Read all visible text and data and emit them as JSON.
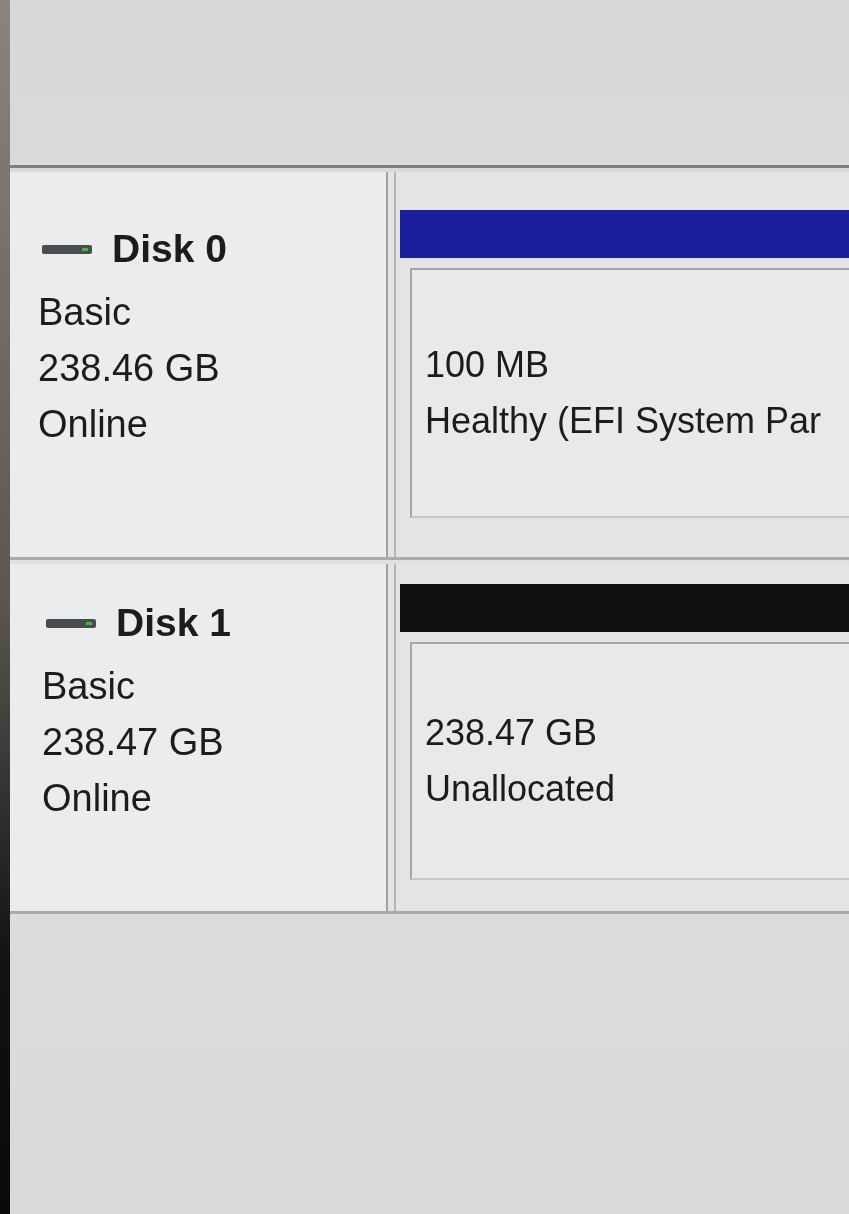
{
  "disks": [
    {
      "name": "Disk 0",
      "type": "Basic",
      "size": "238.46 GB",
      "status": "Online",
      "partitions": [
        {
          "color": "#1b1e9c",
          "size": "100 MB",
          "status": "Healthy (EFI System Par"
        }
      ]
    },
    {
      "name": "Disk 1",
      "type": "Basic",
      "size": "238.47 GB",
      "status": "Online",
      "partitions": [
        {
          "color": "#0f0f12",
          "size": "238.47 GB",
          "status": "Unallocated"
        }
      ]
    }
  ]
}
